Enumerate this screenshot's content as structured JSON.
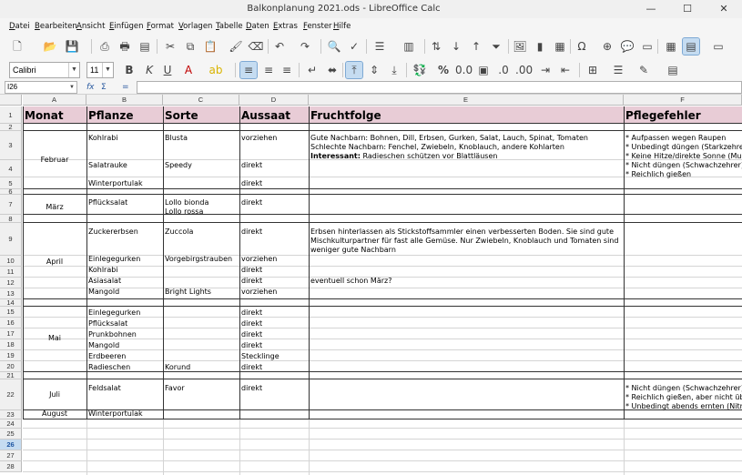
{
  "window": {
    "title": "Balkonplanung 2021.ods - LibreOffice Calc",
    "minimize": "—",
    "maximize": "☐",
    "close": "✕"
  },
  "menu": [
    "Datei",
    "Bearbeiten",
    "Ansicht",
    "Einfügen",
    "Format",
    "Vorlagen",
    "Tabelle",
    "Daten",
    "Extras",
    "Fenster",
    "Hilfe"
  ],
  "formatting": {
    "font_name": "Calibri",
    "font_size": "11"
  },
  "formula_bar": {
    "cell_ref": "I26",
    "fx": "fx",
    "sum": "Σ",
    "equals": "="
  },
  "columns": [
    "A",
    "B",
    "C",
    "D",
    "E",
    "F"
  ],
  "rows": [
    "1",
    "2",
    "3",
    "4",
    "5",
    "6",
    "7",
    "8",
    "9",
    "10",
    "11",
    "12",
    "13",
    "14",
    "15",
    "16",
    "17",
    "18",
    "19",
    "20",
    "21",
    "22",
    "23",
    "24",
    "25",
    "26",
    "27",
    "28"
  ],
  "selected_row": "26",
  "headers": {
    "a": "Monat",
    "b": "Pflanze",
    "c": "Sorte",
    "d": "Aussaat",
    "e": "Fruchtfolge",
    "f": "Pflegefehler"
  },
  "months": {
    "februar": "Februar",
    "maerz": "März",
    "april": "April",
    "mai": "Mai",
    "juli": "Juli",
    "august": "August"
  },
  "cells": {
    "b3": "Kohlrabi",
    "c3": "Blusta",
    "d3": "vorziehen",
    "e3_1": "Gute Nachbarn: Bohnen, Dill, Erbsen, Gurken, Salat, Lauch, Spinat, Tomaten",
    "e3_2": "Schlechte Nachbarn: Fenchel, Zwiebeln, Knoblauch, andere Kohlarten",
    "e3_3_bold": "Interessant:",
    "e3_3_rest": " Radieschen schützen vor Blattläusen",
    "f3_1": "* Aufpassen wegen Raupen",
    "f3_2": "* Unbedingt düngen (Starkzehrer)",
    "f3_3": "* Keine Hitze/direkte Sonne (Mulchen)",
    "f4_1": "* Nicht düngen (Schwachzehrer)",
    "f4_2": "* Reichlich gießen",
    "b4": "Salatrauke",
    "c4": "Speedy",
    "d4": "direkt",
    "b5": "Winterportulak",
    "d5": "direkt",
    "b7": "Pflücksalat",
    "c7_1": "Lollo bionda",
    "c7_2": "Lollo rossa",
    "d7": "direkt",
    "b9": "Zuckererbsen",
    "c9": "Zuccola",
    "d9": "direkt",
    "e9": "Erbsen hinterlassen als Stickstoffsammler einen verbesserten Boden. Sie sind gute Mischkulturpartner für fast alle Gemüse. Nur Zwiebeln, Knoblauch und Tomaten sind weniger gute Nachbarn",
    "b10": "Einlegegurken",
    "c10": "Vorgebirgstrauben",
    "d10": "vorziehen",
    "b11": "Kohlrabi",
    "d11": "direkt",
    "b12": "Asiasalat",
    "d12": "direkt",
    "e12": "eventuell schon März?",
    "b13": "Mangold",
    "c13": "Bright Lights",
    "d13": "vorziehen",
    "b15": "Einlegegurken",
    "d15": "direkt",
    "b16": "Pflücksalat",
    "d16": "direkt",
    "b17": "Prunkbohnen",
    "d17": "direkt",
    "b18": "Mangold",
    "d18": "direkt",
    "b19": "Erdbeeren",
    "d19": "Stecklinge",
    "b20": "Radieschen",
    "c20": "Korund",
    "d20": "direkt",
    "b22": "Feldsalat",
    "c22": "Favor",
    "d22": "direkt",
    "f22_1": "* Nicht düngen (Schwachzehrer)",
    "f22_2": "* Reichlich gießen, aber nicht übergießen",
    "f22_3": "* Unbedingt abends ernten (Nitrat)",
    "b23": "Winterportulak"
  }
}
